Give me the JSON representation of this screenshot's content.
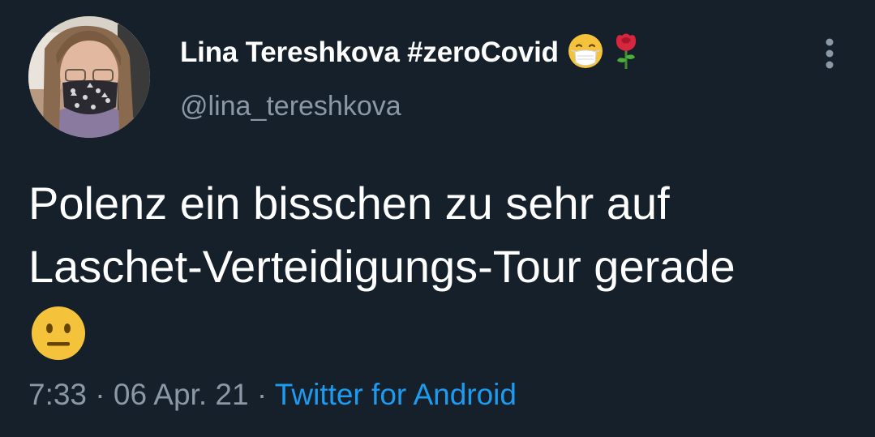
{
  "tweet": {
    "author": {
      "display_name": "Lina Tereshkova #zeroCovid",
      "handle": "@lina_tereshkova",
      "name_emojis": [
        "face-with-medical-mask-emoji",
        "rose-emoji"
      ]
    },
    "text_lines": [
      "Polenz ein bisschen zu sehr auf",
      "Laschet-Verteidigungs-Tour gerade"
    ],
    "body_emoji": "neutral-face-emoji",
    "time": "7:33",
    "separator": "·",
    "date": "06 Apr. 21",
    "source": "Twitter for Android"
  },
  "icons": {
    "more": "vertical-ellipsis-icon"
  },
  "colors": {
    "background": "#15202b",
    "text": "#ffffff",
    "secondary_text": "#8b98a5",
    "link": "#1d9bf0"
  }
}
